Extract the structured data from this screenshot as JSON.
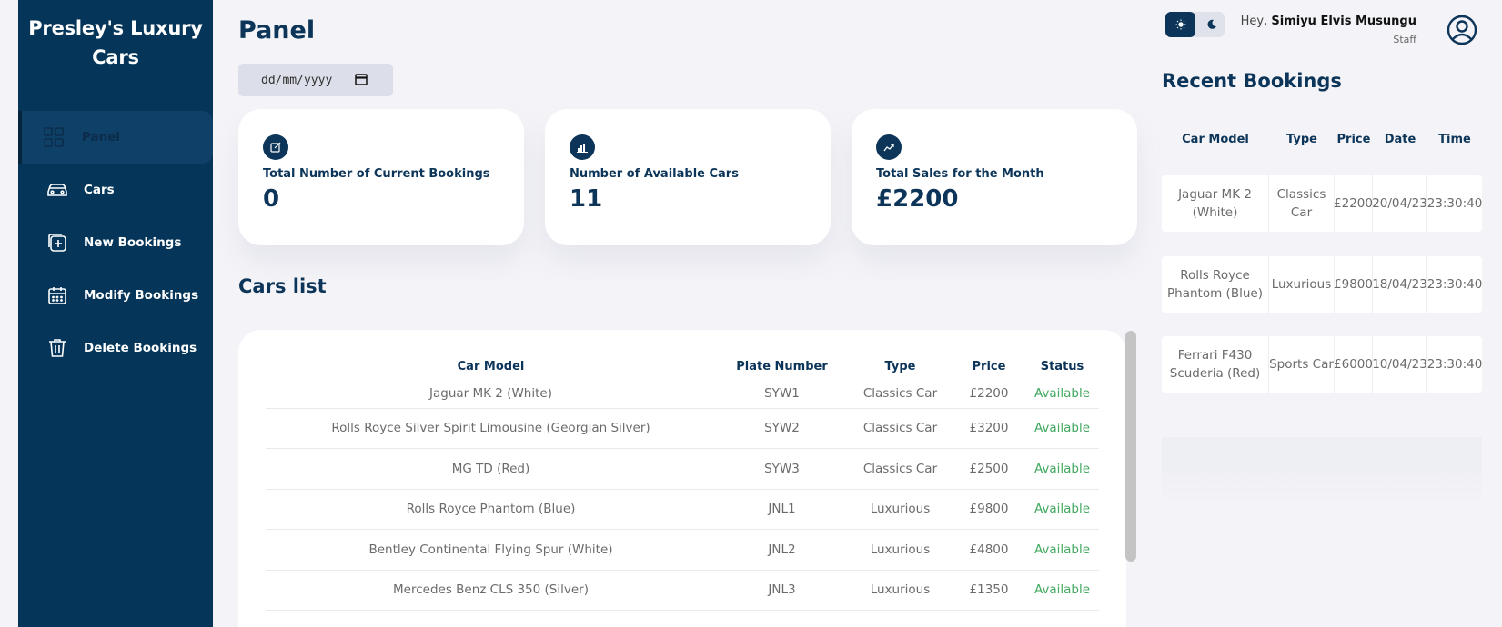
{
  "brand": {
    "line1": "Presley's Luxury",
    "line2": "Cars"
  },
  "sidebar": {
    "items": [
      {
        "label": "Panel",
        "icon": "grid-icon"
      },
      {
        "label": "Cars",
        "icon": "car-icon"
      },
      {
        "label": "New Bookings",
        "icon": "add-square-icon"
      },
      {
        "label": "Modify Bookings",
        "icon": "calendar-icon"
      },
      {
        "label": "Delete Bookings",
        "icon": "trash-icon"
      }
    ]
  },
  "main": {
    "title": "Panel",
    "date_placeholder": "dd/mm/yyyy",
    "cards": [
      {
        "label": "Total Number of Current Bookings",
        "value": "0",
        "icon": "edit-icon"
      },
      {
        "label": "Number of Available Cars",
        "value": "11",
        "icon": "bar-chart-icon"
      },
      {
        "label": "Total Sales for the Month",
        "value": "£2200",
        "icon": "trend-icon"
      }
    ],
    "cars_title": "Cars list",
    "cars_table": {
      "headers": [
        "Car Model",
        "Plate Number",
        "Type",
        "Price",
        "Status"
      ],
      "rows": [
        [
          "Jaguar MK 2 (White)",
          "SYW1",
          "Classics Car",
          "£2200",
          "Available"
        ],
        [
          "Rolls Royce Silver Spirit Limousine (Georgian Silver)",
          "SYW2",
          "Classics Car",
          "£3200",
          "Available"
        ],
        [
          "MG TD (Red)",
          "SYW3",
          "Classics Car",
          "£2500",
          "Available"
        ],
        [
          "Rolls Royce Phantom (Blue)",
          "JNL1",
          "Luxurious",
          "£9800",
          "Available"
        ],
        [
          "Bentley Continental Flying Spur (White)",
          "JNL2",
          "Luxurious",
          "£4800",
          "Available"
        ],
        [
          "Mercedes Benz CLS 350 (Silver)",
          "JNL3",
          "Luxurious",
          "£1350",
          "Available"
        ]
      ]
    }
  },
  "header": {
    "greeting": "Hey,",
    "user_name": "Simiyu Elvis Musungu",
    "role": "Staff"
  },
  "recent": {
    "title": "Recent Bookings",
    "headers": [
      "Car Model",
      "Type",
      "Price",
      "Date",
      "Time"
    ],
    "rows": [
      [
        "Jaguar MK 2 (White)",
        "Classics Car",
        "£2200",
        "20/04/23",
        "23:30:40"
      ],
      [
        "Rolls Royce Phantom (Blue)",
        "Luxurious",
        "£9800",
        "18/04/23",
        "23:30:40"
      ],
      [
        "Ferrari F430 Scuderia (Red)",
        "Sports Car",
        "£6000",
        "10/04/23",
        "23:30:40"
      ]
    ]
  },
  "colors": {
    "primary": "#053659",
    "available": "#41a85f",
    "background": "#f4f4f8"
  }
}
